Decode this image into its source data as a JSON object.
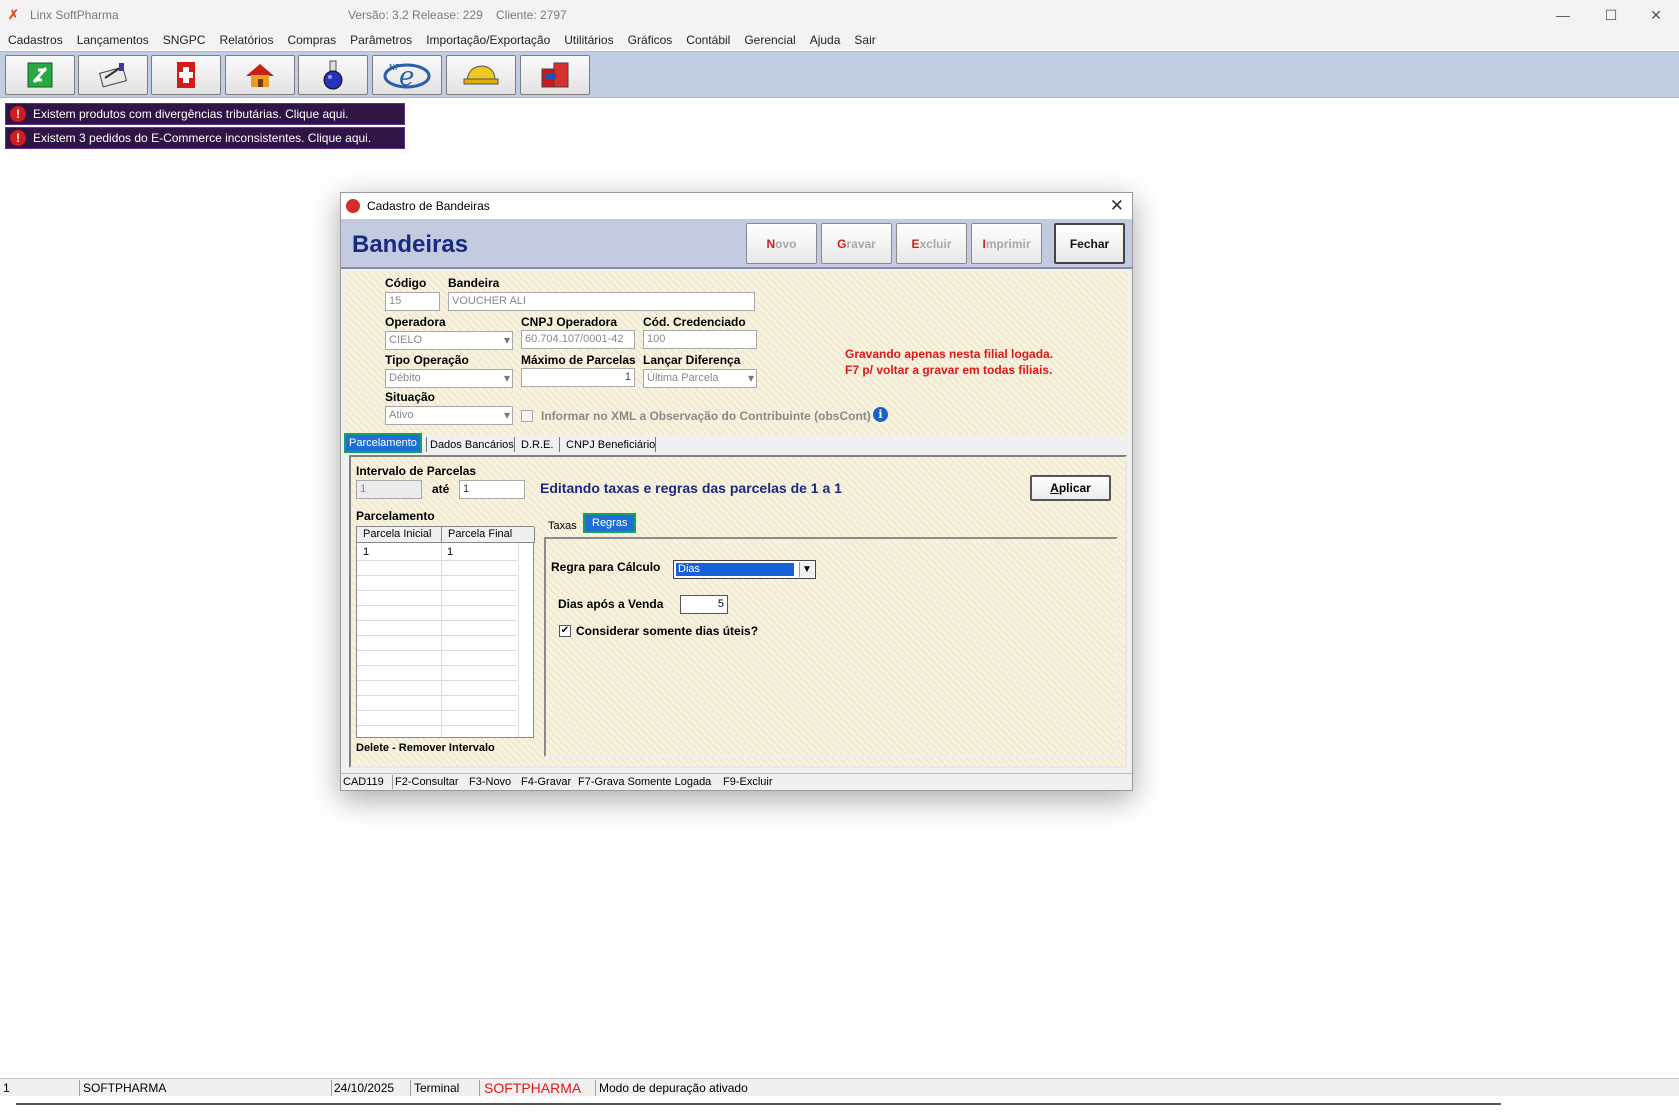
{
  "window": {
    "app_title": "Linx SoftPharma",
    "version": "Versão: 3.2 Release: 229",
    "client": "Cliente: 2797",
    "minimize": "—",
    "maximize": "☐",
    "close": "✕"
  },
  "menu": [
    "Cadastros",
    "Lançamentos",
    "SNGPC",
    "Relatórios",
    "Compras",
    "Parâmetros",
    "Importação/Exportação",
    "Utilitários",
    "Gráficos",
    "Contábil",
    "Gerencial",
    "Ajuda",
    "Sair"
  ],
  "toolbar_icons": [
    "cash-register-icon",
    "notepad-icon",
    "pharmacy-cross-icon",
    "house-icon",
    "flask-icon",
    "nfe-icon",
    "hard-hat-icon",
    "books-icon"
  ],
  "alerts": [
    "Existem produtos com divergências tributárias. Clique aqui.",
    "Existem 3 pedidos do E-Commerce inconsistentes. Clique aqui."
  ],
  "dialog": {
    "title": "Cadastro de Bandeiras",
    "heading": "Bandeiras",
    "buttons": {
      "novo": {
        "hot": "N",
        "rest": "ovo"
      },
      "gravar": {
        "hot": "G",
        "rest": "ravar"
      },
      "excluir": {
        "hot": "E",
        "rest": "xcluir"
      },
      "imprimir": {
        "hot": "I",
        "rest": "mprimir"
      },
      "fechar": "Fechar"
    },
    "form": {
      "codigo_label": "Código",
      "codigo_value": "15",
      "bandeira_label": "Bandeira",
      "bandeira_value": "VOUCHER ALI",
      "operadora_label": "Operadora",
      "operadora_value": "CIELO",
      "cnpj_label": "CNPJ Operadora",
      "cnpj_value": "60.704.107/0001-42",
      "credenciado_label": "Cód. Credenciado",
      "credenciado_value": "100",
      "tipo_label": "Tipo Operação",
      "tipo_value": "Débito",
      "max_parcelas_label": "Máximo de Parcelas",
      "max_parcelas_value": "1",
      "lancar_label": "Lançar Diferença",
      "lancar_value": "Última Parcela",
      "situacao_label": "Situação",
      "situacao_value": "Ativo",
      "xml_label": "Informar no XML a Observação do Contribuinte (obsCont)",
      "warning_1": "Gravando apenas nesta filial logada.",
      "warning_2": "F7 p/ voltar a gravar em todas filiais."
    },
    "tabs": [
      "Parcelamento",
      "Dados Bancários",
      "D.R.E.",
      "CNPJ Beneficiário"
    ],
    "parcelamento": {
      "intervalo_label": "Intervalo de Parcelas",
      "de_value": "1",
      "ate_label": "até",
      "ate_value": "1",
      "editing_text": "Editando taxas e regras das parcelas de 1 a 1",
      "aplicar_hot": "A",
      "aplicar_rest": "plicar",
      "grid_label": "Parcelamento",
      "grid_headers": [
        "Parcela Inicial",
        "Parcela Final"
      ],
      "grid_rows": [
        [
          "1",
          "1"
        ]
      ],
      "delete_hint": "Delete - Remover Intervalo",
      "subtabs": [
        "Taxas",
        "Regras"
      ],
      "regra_label": "Regra para Cálculo",
      "regra_value": "Dias",
      "dias_label": "Dias após a Venda",
      "dias_value": "5",
      "uteis_label": "Considerar somente dias úteis?"
    },
    "status": [
      "CAD119",
      "F2-Consultar",
      "F3-Novo",
      "F4-Gravar",
      "F7-Grava Somente Logada",
      "F9-Excluir"
    ]
  },
  "statusbar": {
    "num": "1",
    "company": "SOFTPHARMA",
    "date": "24/10/2025",
    "terminal": "Terminal",
    "brand": "SOFTPHARMA",
    "debug": "Modo de depuração ativado"
  }
}
